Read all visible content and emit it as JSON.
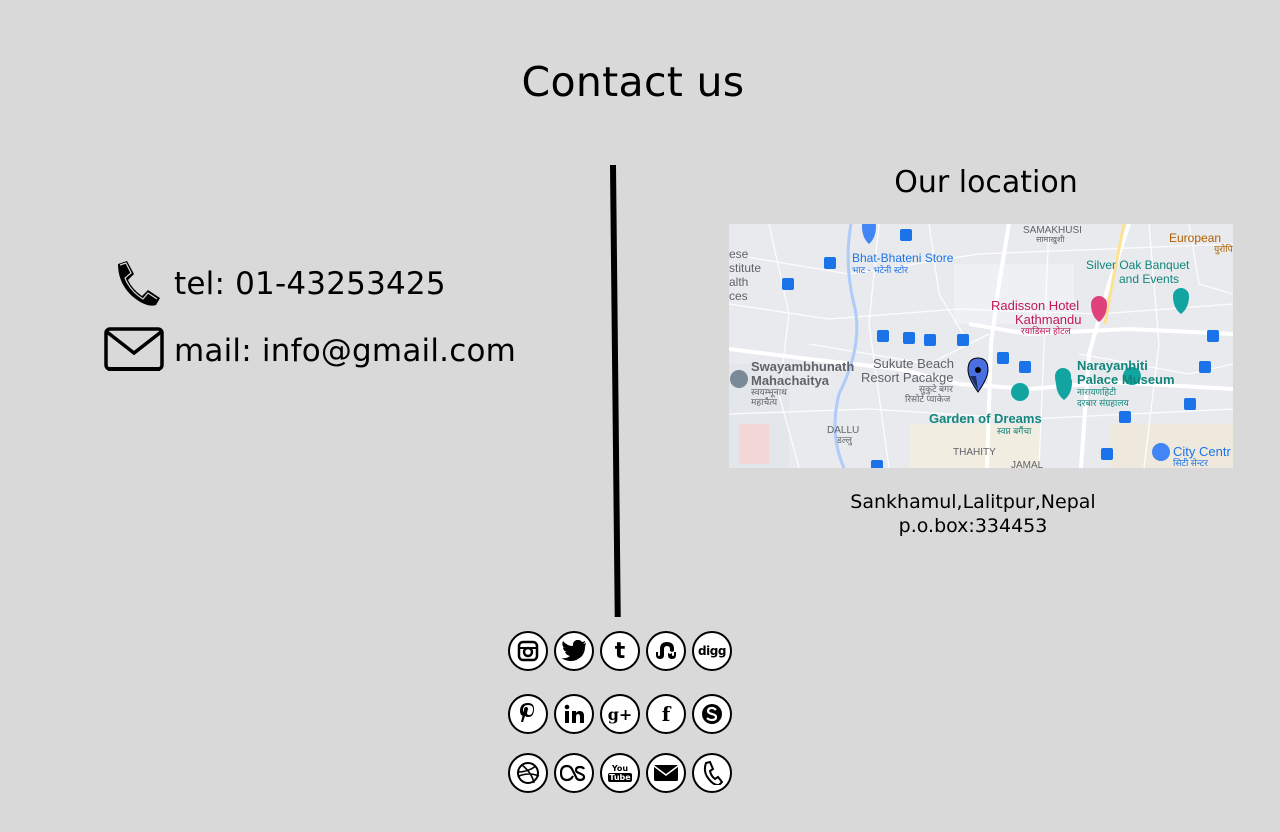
{
  "page": {
    "title": "Contact us"
  },
  "contact": {
    "phone": {
      "icon": "phone-icon",
      "text": "tel: 01-43253425"
    },
    "mail": {
      "icon": "envelope-icon",
      "text": "mail: info@gmail.com"
    }
  },
  "location": {
    "title": "Our location",
    "address_line1": "Sankhamul,Lalitpur,Nepal",
    "address_line2": "p.o.box:334453",
    "map": {
      "labels": {
        "samakhusi": "SAMAKHUSI",
        "samakhusi_np": "सामाखुशी",
        "european": "European",
        "european_np": "युरोपि",
        "bhatbhateni": "Bhat-Bhateni Store",
        "bhatbhateni_np": "भाट - भटेनी स्टोर",
        "silveroak1": "Silver Oak Banquet",
        "silveroak2": "and Events",
        "radisson1": "Radisson Hotel",
        "radisson2": "Kathmandu",
        "radisson_np": "रयाडिसन होटल",
        "swayambhu1": "Swayambhunath",
        "swayambhu2": "Mahachaitya",
        "swayambhu_np1": "स्वयम्भूनाथ",
        "swayambhu_np2": "महाचैत्य",
        "sukute1": "Sukute Beach",
        "sukute2": "Resort Pacakge",
        "sukute_np1": "सुकुटे बगर",
        "sukute_np2": "रिसोर्ट प्याकेज",
        "narayanhiti1": "Narayanhiti",
        "narayanhiti2": "Palace Museum",
        "narayanhiti_np1": "नारायणहिटी",
        "narayanhiti_np2": "दरबार संग्रहालय",
        "garden": "Garden of Dreams",
        "garden_np": "स्वप्न बगैंचा",
        "dallu": "DALLU",
        "dallu_np": "डल्लु",
        "thahity": "THAHITY",
        "jamal": "JAMAL",
        "city1": "City Centr",
        "city_np": "सिटी सेन्टर",
        "edge1": "ese",
        "edge2": "stitute",
        "edge3": "alth",
        "edge4": "ces"
      }
    }
  },
  "social": {
    "row1": [
      "instagram-icon",
      "twitter-icon",
      "tumblr-icon",
      "stumbleupon-icon",
      "digg-icon"
    ],
    "row2": [
      "pinterest-icon",
      "linkedin-icon",
      "google-plus-icon",
      "facebook-icon",
      "skype-icon"
    ],
    "row3": [
      "dribbble-icon",
      "lastfm-icon",
      "youtube-icon",
      "email-icon",
      "phone-icon"
    ],
    "glyphs": {
      "tumblr": "t",
      "digg": "digg",
      "gplus": "g+",
      "facebook": "f",
      "youtube_top": "You",
      "youtube_bottom": "Tube"
    }
  },
  "colors": {
    "background": "#d9d9d9",
    "text": "#000000",
    "map_bg": "#e7e9ec",
    "map_pin": "#4a6fe0",
    "map_teal": "#12857c",
    "map_pink": "#c2185b",
    "map_blue": "#1a73e8"
  }
}
